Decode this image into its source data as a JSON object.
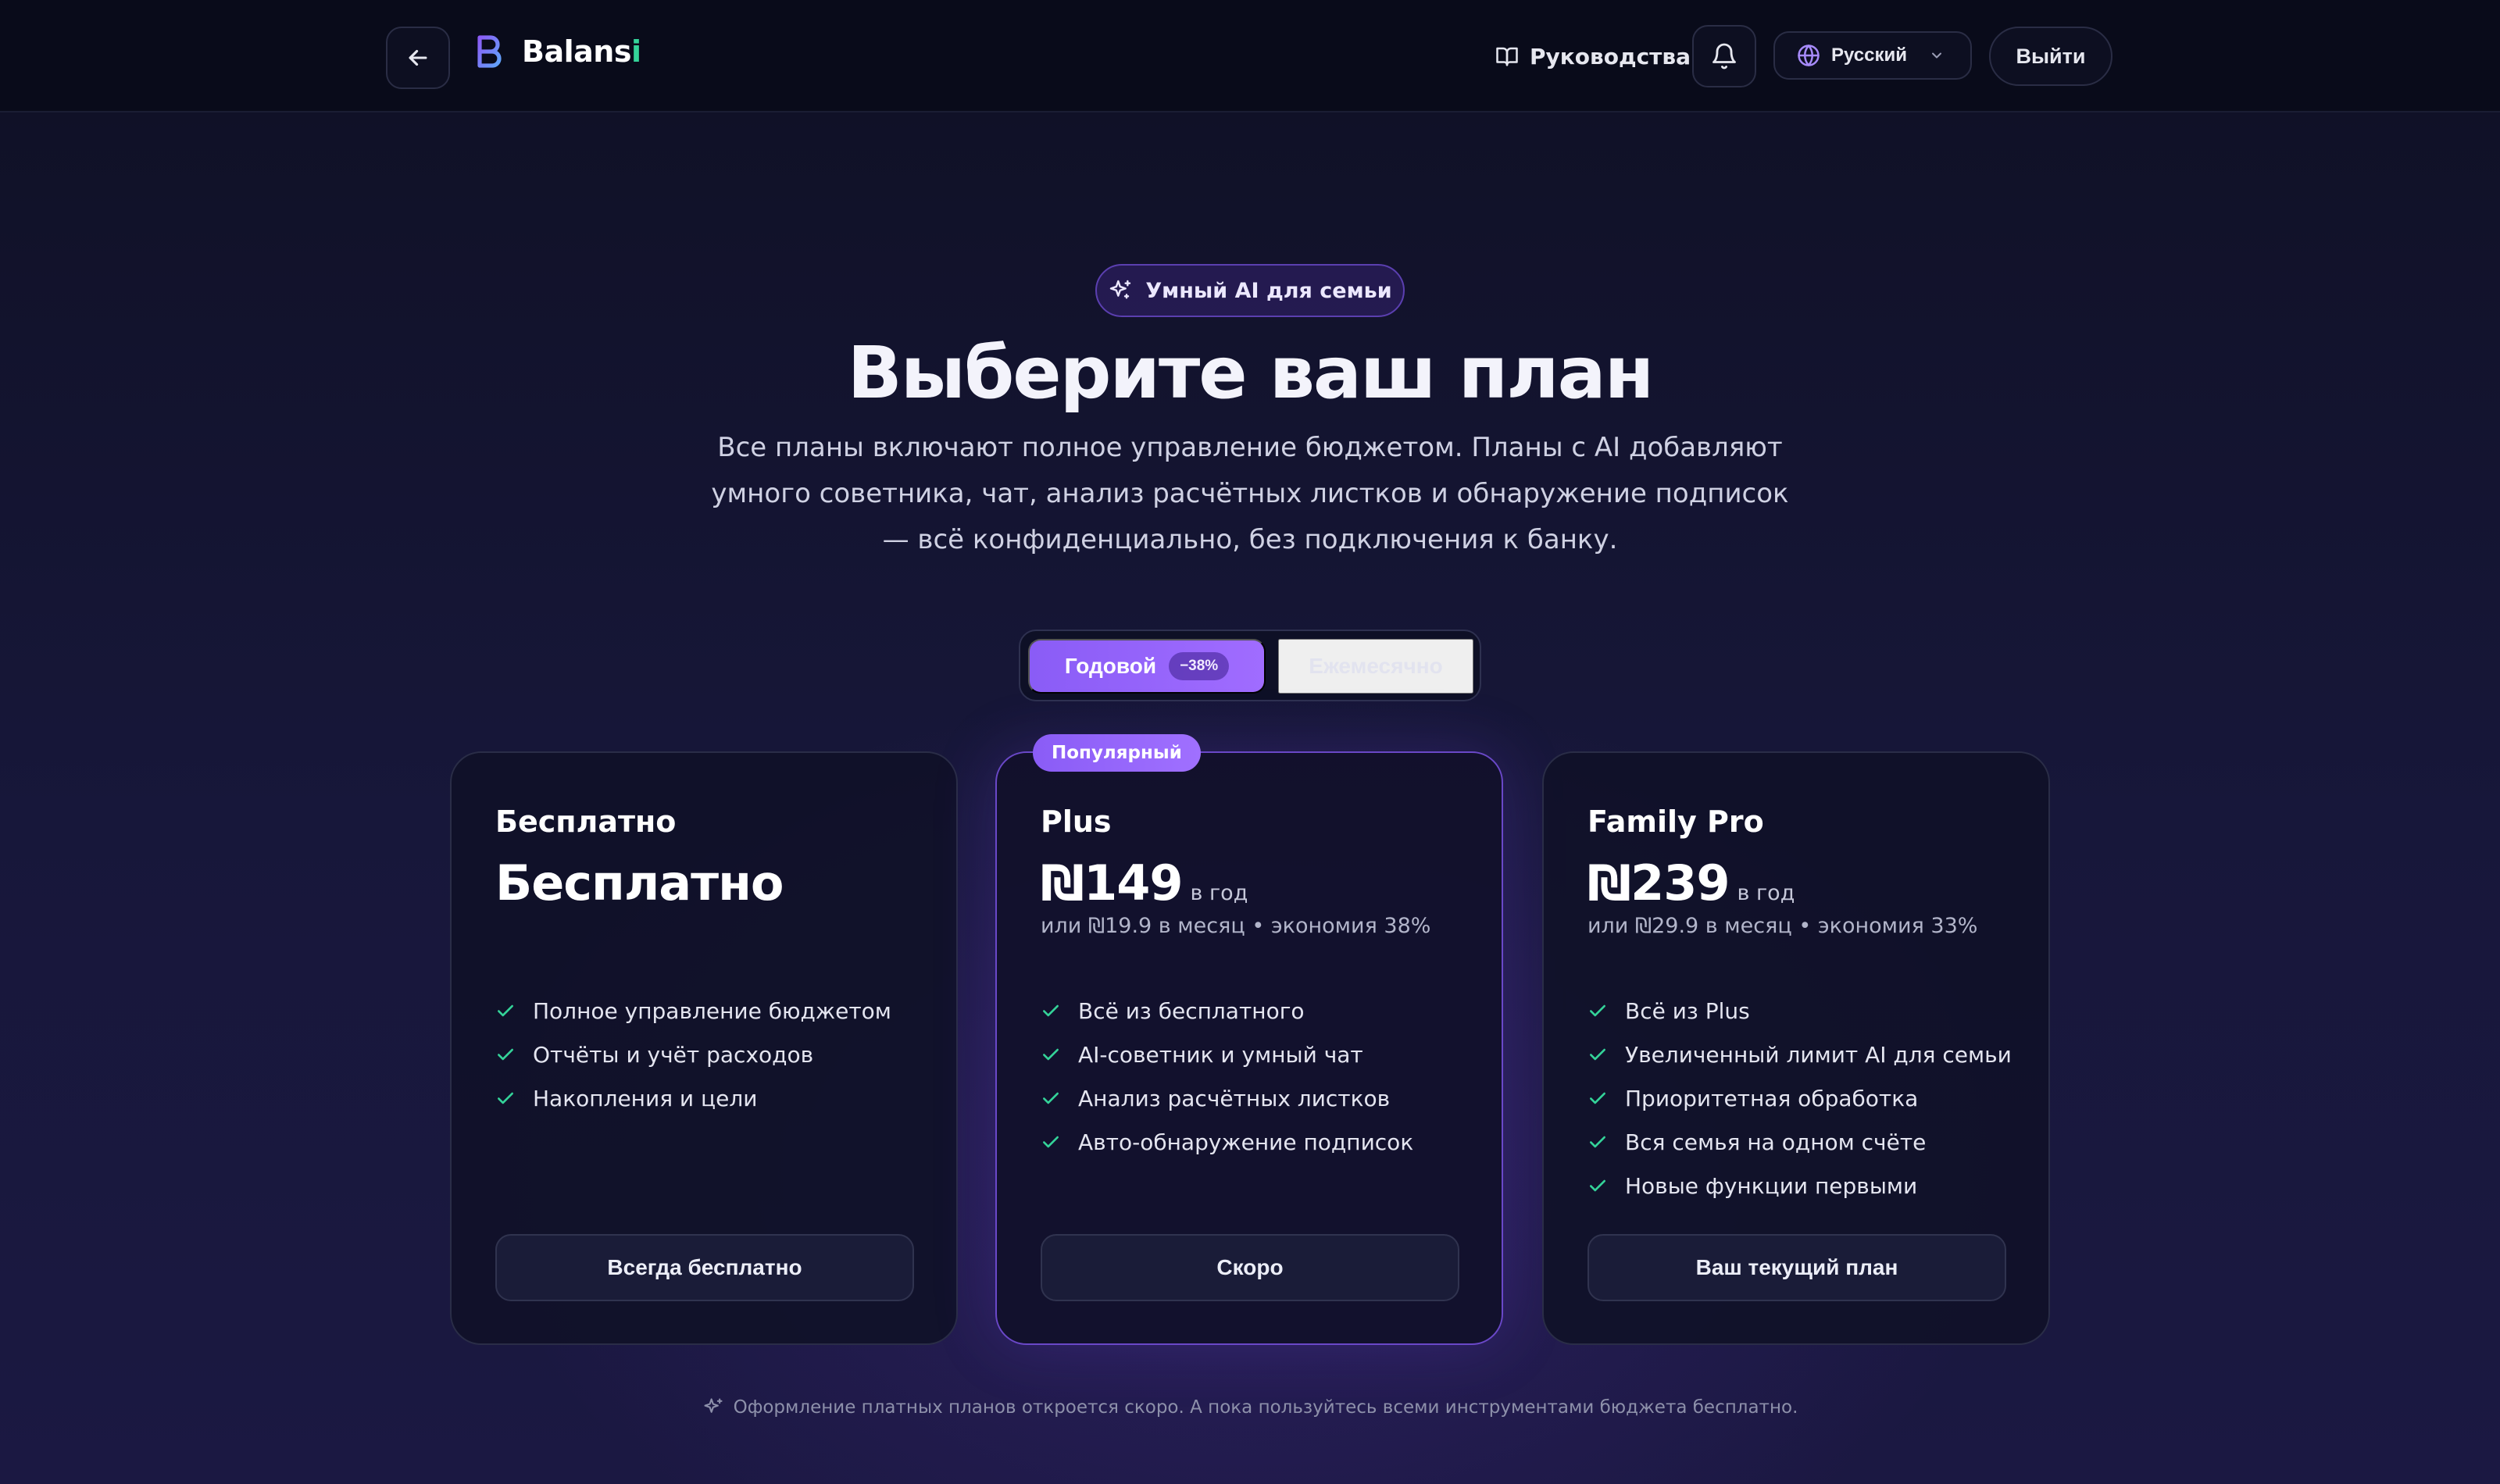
{
  "header": {
    "brand": {
      "prefix": "Balans",
      "accent": "i"
    },
    "guides_label": "Руководства",
    "language": {
      "selected": "Русский"
    },
    "logout_label": "Выйти"
  },
  "hero": {
    "badge": "Умный AI для семьи",
    "title": "Выберите ваш план",
    "subtitle": "Все планы включают полное управление бюджетом. Планы с AI добавляют умного советника, чат, анализ расчётных листков и обнаружение подписок — всё конфиденциально, без подключения к банку."
  },
  "billing": {
    "yearly_label": "Годовой",
    "yearly_discount": "−38%",
    "monthly_label": "Ежемесячно",
    "selected": "yearly"
  },
  "plans": [
    {
      "name": "Бесплатно",
      "price": "Бесплатно",
      "period": "",
      "sub": "",
      "features": [
        "Полное управление бюджетом",
        "Отчёты и учёт расходов",
        "Накопления и цели"
      ],
      "cta": "Всегда бесплатно"
    },
    {
      "name": "Plus",
      "badge": "Популярный",
      "price": "₪149",
      "period": "в год",
      "sub": "или ₪19.9 в месяц • экономия 38%",
      "features": [
        "Всё из бесплатного",
        "AI-советник и умный чат",
        "Анализ расчётных листков",
        "Авто-обнаружение подписок"
      ],
      "cta": "Скоро"
    },
    {
      "name": "Family Pro",
      "price": "₪239",
      "period": "в год",
      "sub": "или ₪29.9 в месяц • экономия 33%",
      "features": [
        "Всё из Plus",
        "Увеличенный лимит AI для семьи",
        "Приоритетная обработка",
        "Вся семья на одном счёте",
        "Новые функции первыми"
      ],
      "cta": "Ваш текущий план"
    }
  ],
  "footnote": "Оформление платных планов откроется скоро. А пока пользуйтесь всеми инструментами бюджета бесплатно.",
  "colors": {
    "accent_purple": "#8a5cf6",
    "check_green": "#34d399",
    "brand_green": "#34d399",
    "background": "#14142e"
  },
  "icons": {
    "back": "arrow-left-icon",
    "logo": "logo-b-icon",
    "guides": "book-open-icon",
    "bell": "bell-icon",
    "globe": "globe-icon",
    "chevron": "chevron-down-icon",
    "sparkle": "sparkles-icon",
    "check": "check-icon"
  }
}
